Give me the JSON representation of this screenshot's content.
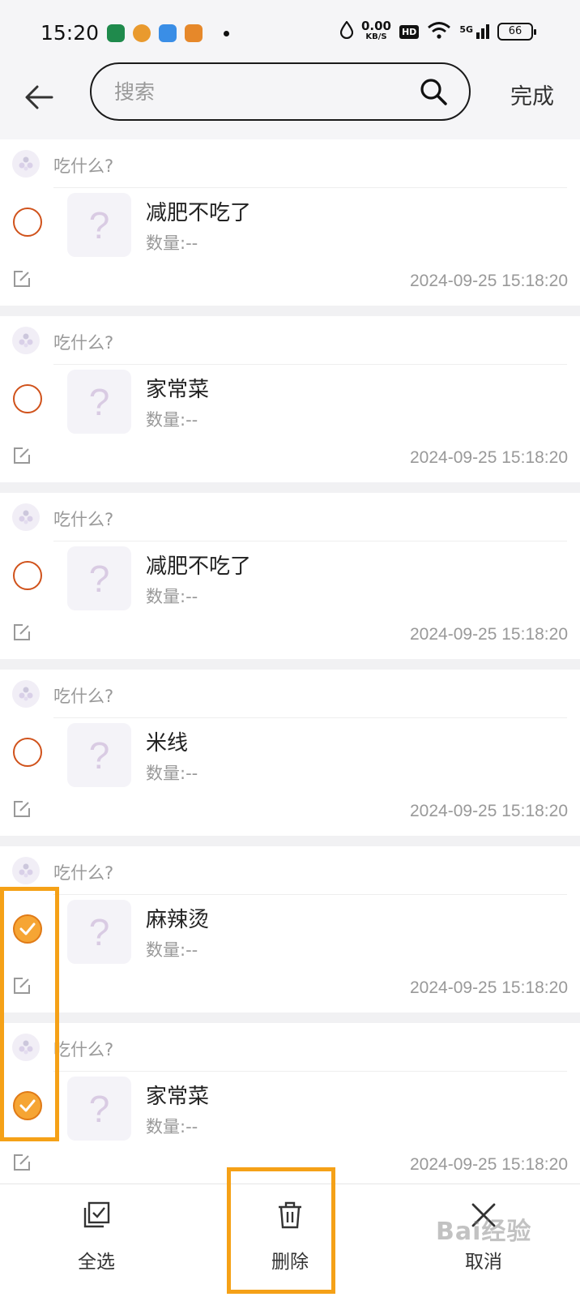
{
  "status_bar": {
    "time": "15:20",
    "net_speed": "0.00",
    "net_unit": "KB/S",
    "hd": "HD",
    "signal": "5G",
    "battery": "66",
    "app_icons": [
      {
        "name": "oppo-app-icon",
        "color": "#1f8a4c"
      },
      {
        "name": "app-icon-orange",
        "color": "#e99a2e"
      },
      {
        "name": "app-icon-blue",
        "color": "#3a8ee6"
      },
      {
        "name": "app-icon-game",
        "color": "#e6882a"
      }
    ]
  },
  "header": {
    "back_icon": "arrow-left-icon",
    "search_placeholder": "搜索",
    "done_label": "完成"
  },
  "items": [
    {
      "group": "吃什么?",
      "name": "减肥不吃了",
      "qty": "数量:--",
      "time": "2024-09-25 15:18:20",
      "checked": false
    },
    {
      "group": "吃什么?",
      "name": "家常菜",
      "qty": "数量:--",
      "time": "2024-09-25 15:18:20",
      "checked": false
    },
    {
      "group": "吃什么?",
      "name": "减肥不吃了",
      "qty": "数量:--",
      "time": "2024-09-25 15:18:20",
      "checked": false
    },
    {
      "group": "吃什么?",
      "name": "米线",
      "qty": "数量:--",
      "time": "2024-09-25 15:18:20",
      "checked": false
    },
    {
      "group": "吃什么?",
      "name": "麻辣烫",
      "qty": "数量:--",
      "time": "2024-09-25 15:18:20",
      "checked": true
    },
    {
      "group": "吃什么?",
      "name": "家常菜",
      "qty": "数量:--",
      "time": "2024-09-25 15:18:20",
      "checked": true
    }
  ],
  "thumb_placeholder": "?",
  "bottom_bar": {
    "select_all": "全选",
    "delete": "删除",
    "cancel": "取消"
  },
  "watermark": "Bai经验",
  "colors": {
    "accent": "#f6a534",
    "unchecked_ring": "#d0521b",
    "highlight": "#f5a117"
  }
}
